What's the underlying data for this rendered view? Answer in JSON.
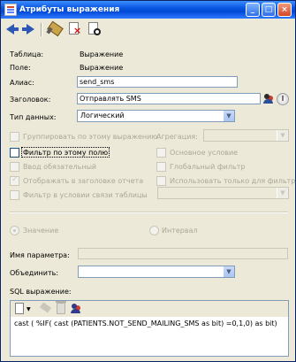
{
  "window": {
    "title": "Атрибуты выражения"
  },
  "form": {
    "table_label": "Таблица:",
    "table_value": "Выражение",
    "field_label": "Поле:",
    "field_value": "Выражение",
    "alias_label": "Алиас:",
    "alias_value": "send_sms",
    "heading_label": "Заголовок:",
    "heading_value": "Отправлять SMS",
    "datatype_label": "Тип данных:",
    "datatype_value": "Логический",
    "group_by_label": "Группировать по этому выражению",
    "aggregation_label": "Агрегация:",
    "aggregation_value": "",
    "filter_by_field_label": "Фильтр по этому полю",
    "main_condition_label": "Основное условие",
    "required_input_label": "Ввод обязательный",
    "global_filter_label": "Глобальный фильтр",
    "show_in_report_header_label": "Отображать в заголовке отчета",
    "use_only_for_filter_label": "Использовать только для фильтра",
    "filter_in_table_link_label": "Фильтр в условии связи таблицы",
    "table_link_value": "",
    "radio_value_label": "Значение",
    "radio_interval_label": "Интервал",
    "param_name_label": "Имя параметра:",
    "param_name_value": "",
    "combine_label": "Объединить:",
    "combine_value": "",
    "sql_label": "SQL выражение:",
    "sql_value": "cast ( %IF( cast (PATIENTS.NOT_SEND_MAILING_SMS as bit) =0,1,0) as bit)"
  },
  "icons": {
    "window": "window-icon",
    "toolbar": [
      "arrow-left-icon",
      "arrow-right-icon",
      "wand-icon",
      "delete-document-icon",
      "cancel-document-icon"
    ],
    "side": [
      "persons-icon",
      "circle-icon"
    ],
    "sql": [
      "new-document-icon",
      "dropdown-arrow-icon",
      "wand-icon",
      "trash-icon",
      "persons-icon"
    ]
  },
  "colors": {
    "titlebar": "#0a57e0",
    "window_bg": "#ece9d8",
    "field_border": "#7f9db9",
    "disabled_text": "#aca899"
  }
}
